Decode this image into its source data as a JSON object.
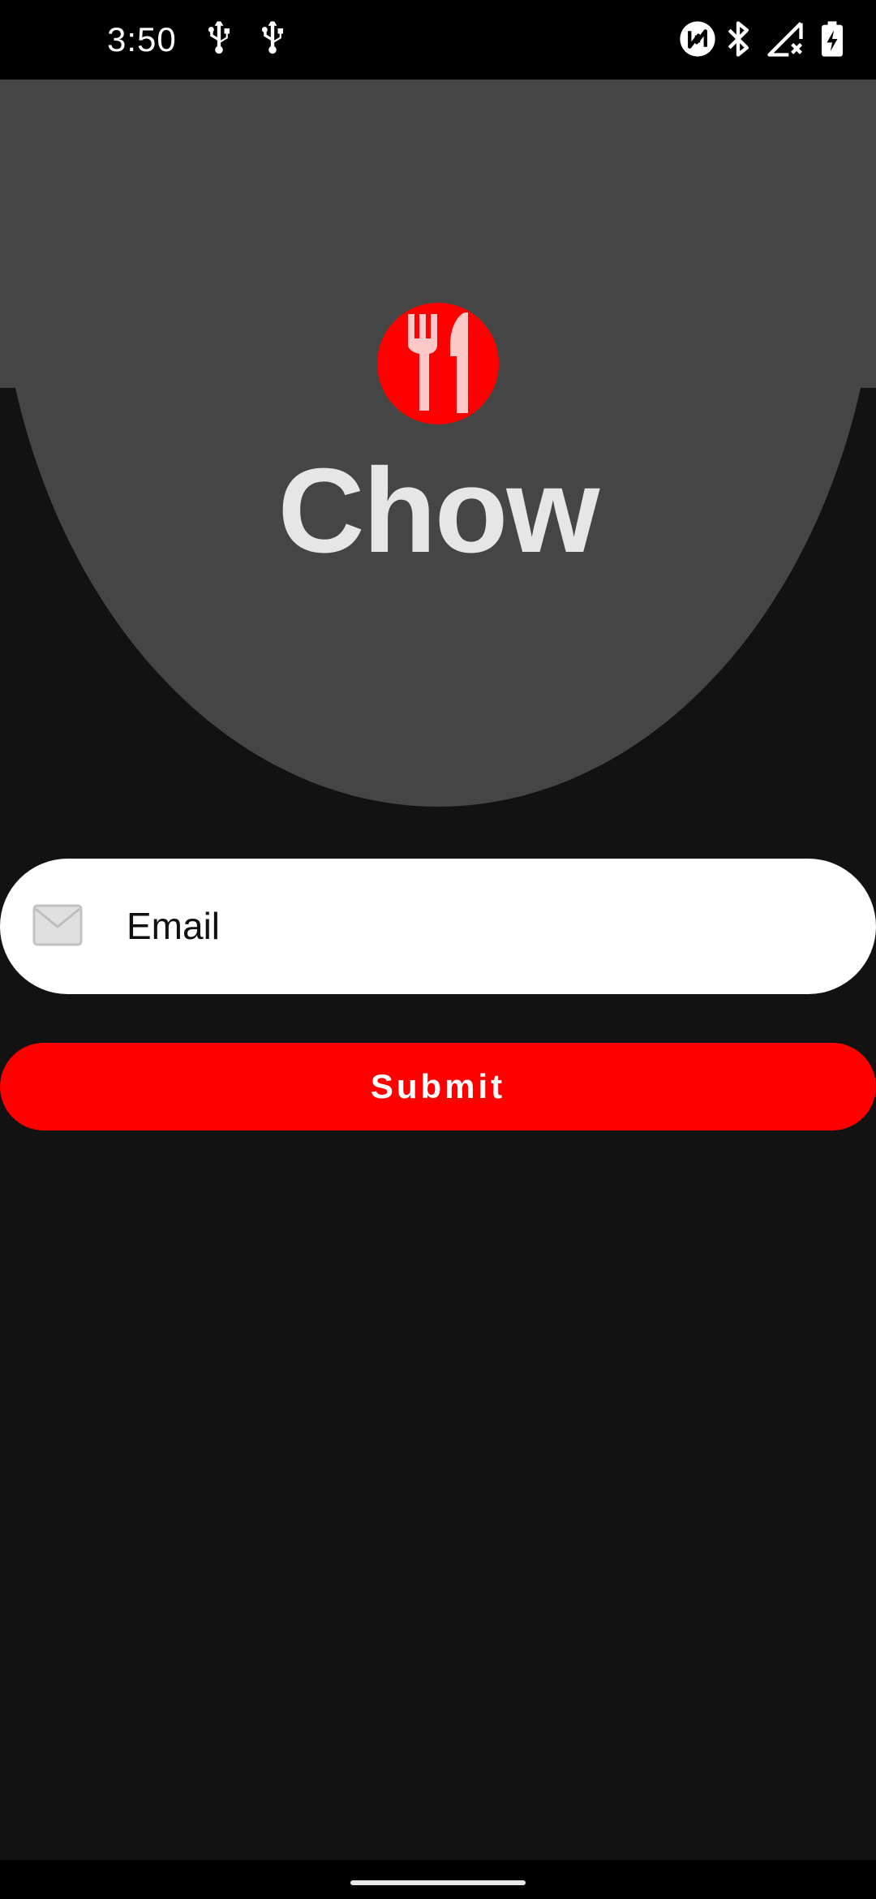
{
  "status_bar": {
    "time": "3:50",
    "left_icons": [
      "usb-icon",
      "usb-icon"
    ],
    "right_icons": [
      "nfc-icon",
      "bluetooth-icon",
      "signal-no-service-icon",
      "battery-charging-icon"
    ]
  },
  "header": {
    "app_name": "Chow",
    "logo_icon": "fork-knife-icon",
    "logo_color": "#ff0000",
    "background_color": "#454545"
  },
  "form": {
    "email": {
      "placeholder": "Email",
      "value": "",
      "icon": "mail-icon"
    },
    "submit_label": "Submit",
    "submit_color": "#ff0000"
  }
}
